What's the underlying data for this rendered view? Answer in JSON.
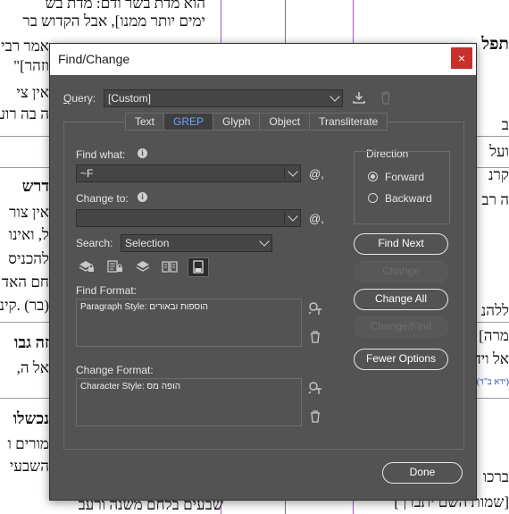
{
  "background": {
    "lines": [
      {
        "text": "הוא מדת בשר ודם: מדת בש",
        "bold": false
      },
      {
        "text": "ימים יותר ממנו], אבל הקדוש בר",
        "bold": false
      },
      {
        "text": "אמר רבי",
        "bold": false
      },
      {
        "text": "וזהר]\"",
        "bold": false
      },
      {
        "text": "אין צי",
        "bold": false
      },
      {
        "text": "ה בה רוע",
        "bold": false
      },
      {
        "text": "דרש",
        "bold": true
      },
      {
        "text": "אין צור",
        "bold": false
      },
      {
        "text": "ל, ואינו",
        "bold": false
      },
      {
        "text": "להכניס",
        "bold": false
      },
      {
        "text": "חם האד",
        "bold": false
      },
      {
        "text": "(בר) .קינו",
        "bold": false
      },
      {
        "text": "זה גבו",
        "bold": true
      },
      {
        "text": "אל ה,",
        "bold": false
      },
      {
        "text": "נכשלו",
        "bold": true
      },
      {
        "text": "מורים ו",
        "bold": false
      },
      {
        "text": "השבעי",
        "bold": false
      },
      {
        "text": "שבעים בלחם משנה ורעב",
        "bold": false
      }
    ],
    "right_lines": [
      {
        "text": "תפל",
        "bold": true
      },
      {
        "text": "ב",
        "bold": false
      },
      {
        "text": "ועל",
        "bold": false
      },
      {
        "text": "קרנ",
        "bold": false
      },
      {
        "text": "ה רב",
        "bold": false
      },
      {
        "text": "ללהנ",
        "bold": false
      },
      {
        "text": "מרה]",
        "bold": false
      },
      {
        "text": "אל ויד",
        "bold": false
      },
      {
        "text": "(ידא ב\"ד)¶",
        "bold": false
      },
      {
        "text": "ברכו",
        "bold": false
      },
      {
        "text": "[שמות השם יתברך]",
        "bold": false
      }
    ]
  },
  "dialog": {
    "title": "Find/Change",
    "close": "×",
    "query_label": "Query:",
    "query_value": "[Custom]",
    "tabs": [
      {
        "label": "Text",
        "active": false
      },
      {
        "label": "GREP",
        "active": true
      },
      {
        "label": "Glyph",
        "active": false
      },
      {
        "label": "Object",
        "active": false
      },
      {
        "label": "Transliterate",
        "active": false
      }
    ],
    "find_what_label": "Find what:",
    "find_what_value": "~F",
    "change_to_label": "Change to:",
    "change_to_value": "",
    "special_char": "@,",
    "search_label": "Search:",
    "search_value": "Selection",
    "find_format_label": "Find Format:",
    "find_format_value": "Paragraph Style: הוספות ובאורים",
    "change_format_label": "Change Format:",
    "change_format_value": "Character Style: הופה מס",
    "direction_label": "Direction",
    "direction_forward": "Forward",
    "direction_backward": "Backward",
    "buttons": {
      "find_next": "Find Next",
      "change": "Change",
      "change_all": "Change All",
      "change_find": "Change/Find",
      "fewer_options": "Fewer Options",
      "done": "Done"
    }
  }
}
